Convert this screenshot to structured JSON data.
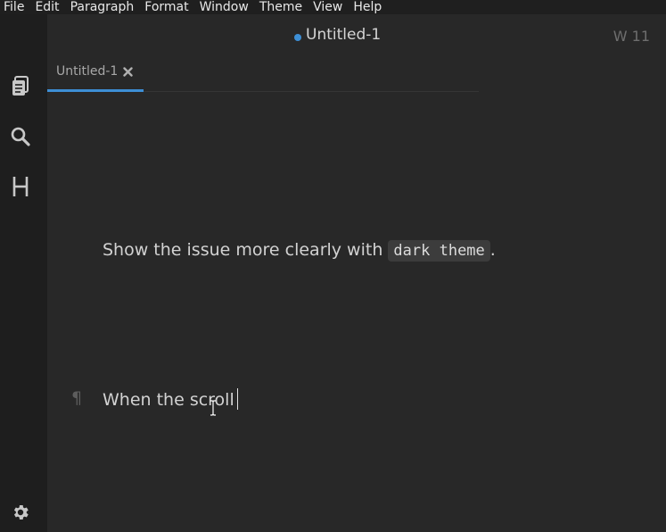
{
  "menubar": {
    "items": [
      "File",
      "Edit",
      "Paragraph",
      "Format",
      "Window",
      "Theme",
      "View",
      "Help"
    ]
  },
  "sidebar": {
    "icons": [
      "files-icon",
      "search-icon",
      "heading-outline-icon"
    ],
    "settings_icon": "gear-icon"
  },
  "header": {
    "title": "Untitled-1",
    "unsaved_dot_color": "#3d8fd6",
    "word_count": "W 11"
  },
  "tabs": [
    {
      "label": "Untitled-1",
      "active": true,
      "close_icon": "close-icon"
    }
  ],
  "editor": {
    "paragraph1": {
      "before": "Show the issue more clearly with ",
      "code": "dark theme",
      "after": "."
    },
    "paragraph2": {
      "marker": "¶",
      "text": "When the scroll"
    }
  },
  "colors": {
    "accent": "#3d8fd6",
    "background": "#282828",
    "sidebar": "#1e1e1e"
  }
}
